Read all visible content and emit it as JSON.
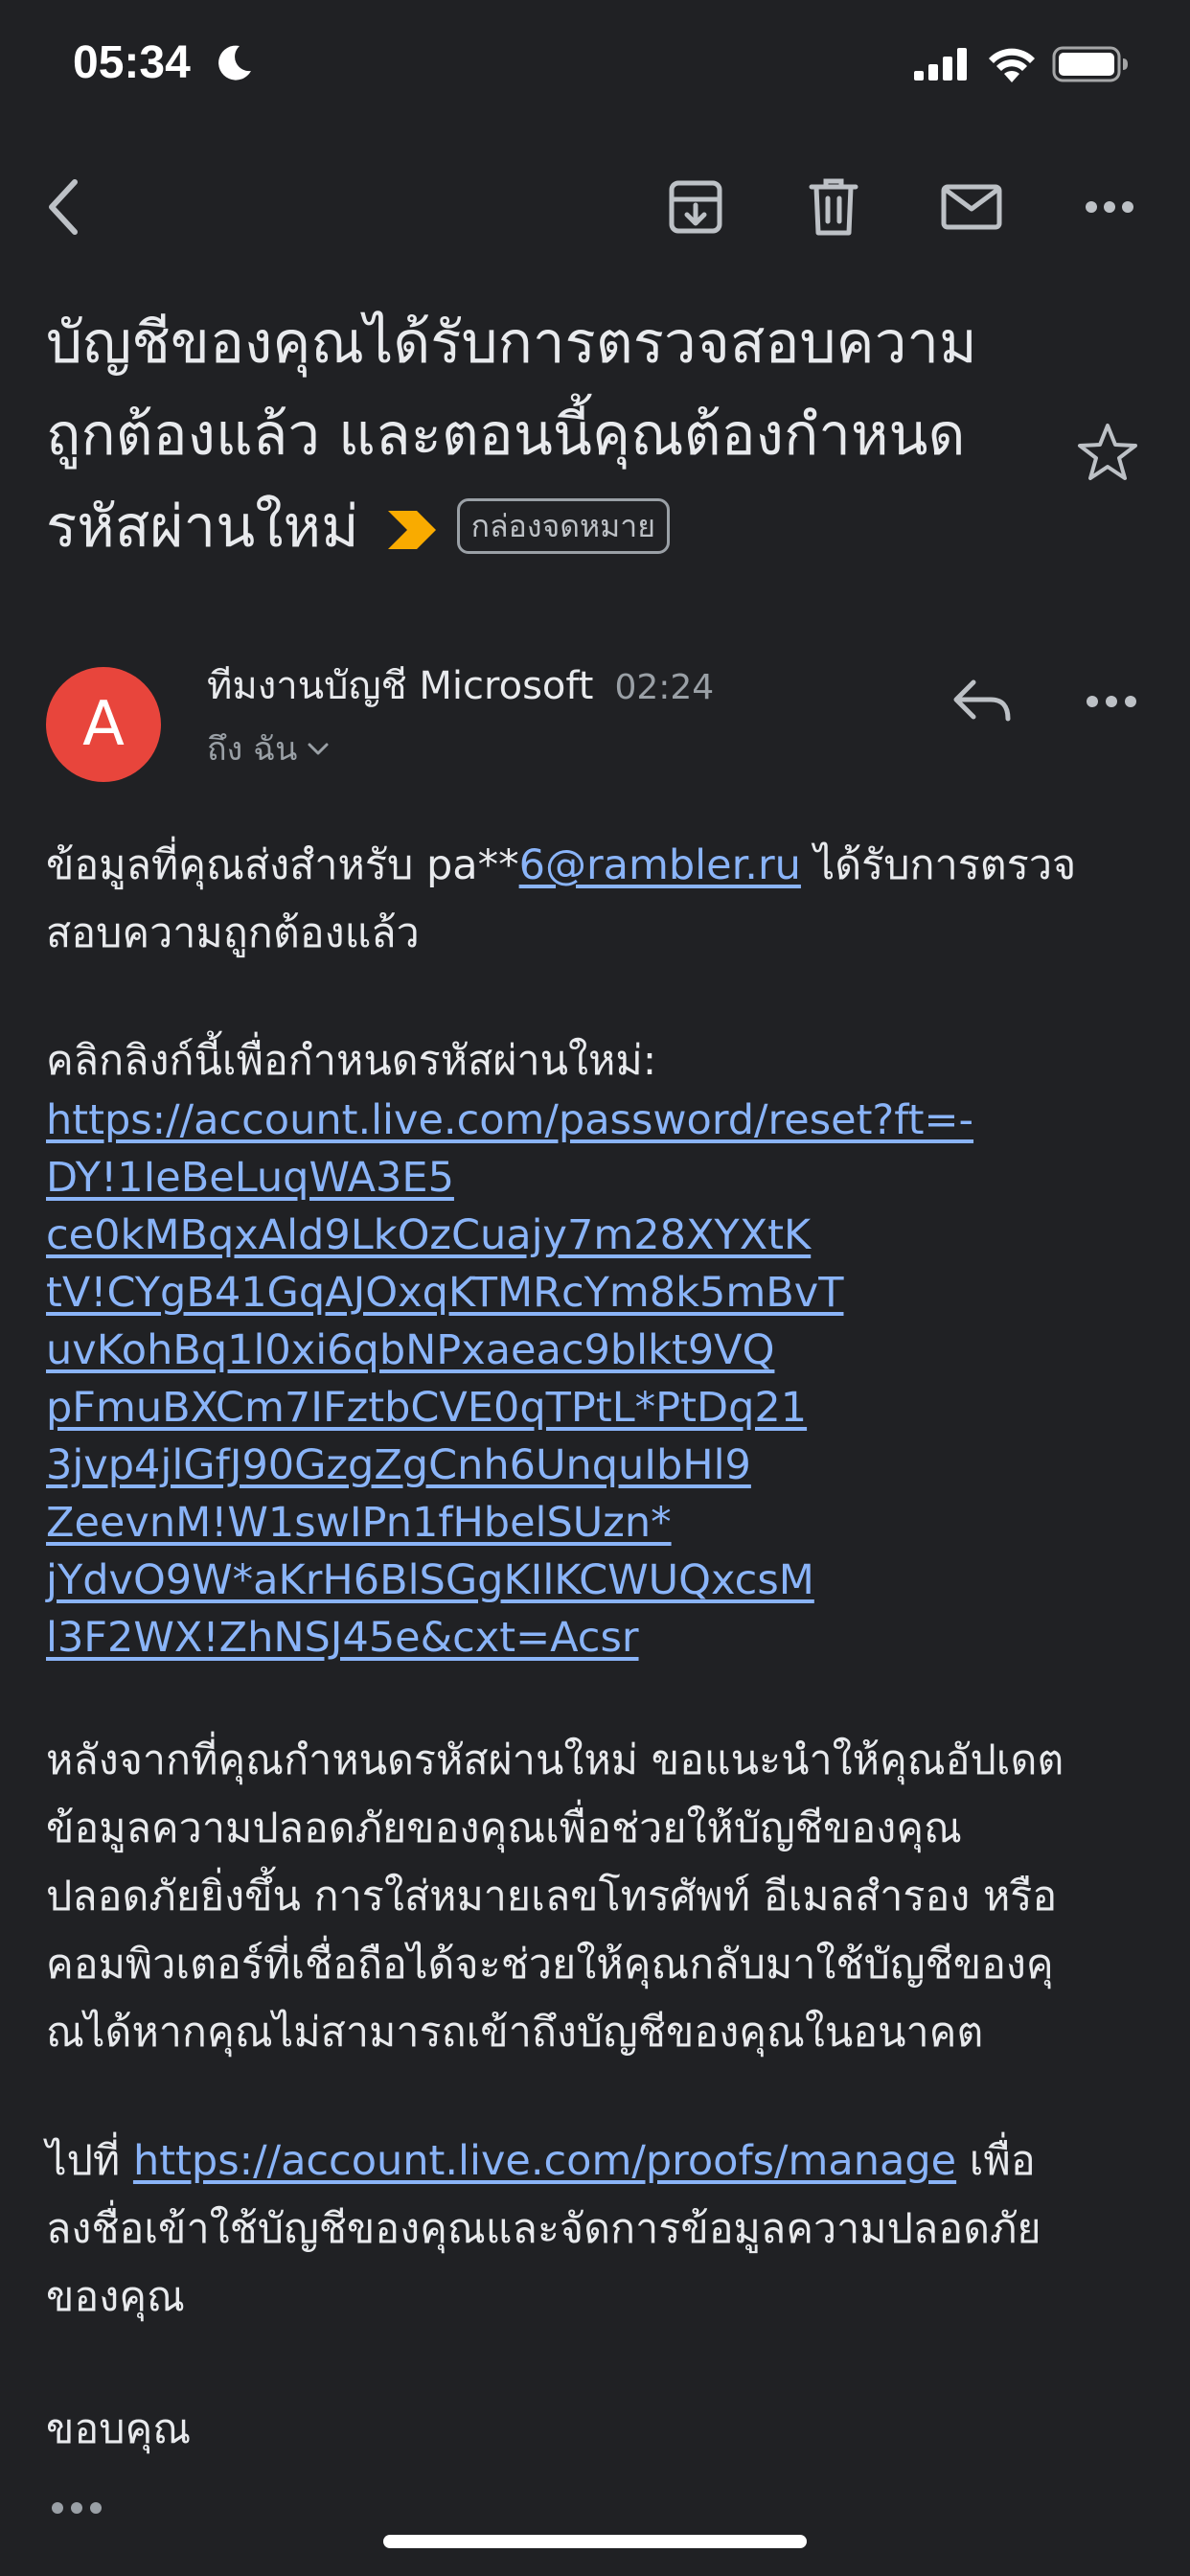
{
  "status_bar": {
    "time": "05:34",
    "icons": [
      "moon-icon",
      "signal-icon",
      "wifi-icon",
      "battery-icon"
    ]
  },
  "toolbar": {
    "icons": [
      "back-arrow-icon",
      "archive-icon",
      "trash-icon",
      "mail-icon",
      "more-icon"
    ]
  },
  "email": {
    "subject_lines": [
      "บัญชีของคุณได้รับการตรวจสอบความ",
      "ถูกต้องแล้ว และตอนนี้คุณต้องกำหนด",
      "รหัสผ่านใหม่"
    ],
    "label": "กล่องจดหมาย",
    "sender": {
      "initial": "A",
      "name": "ทีมงานบัญชี Microsoft",
      "time": "02:24",
      "recipient": "ถึง ฉัน"
    },
    "body": {
      "para1_prefix": "ข้อมูลที่คุณส่งสำหรับ pa**",
      "para1_email": "6@rambler.ru",
      "para1_suffix": " ได้รับการตรวจ",
      "para1_line2": "สอบความถูกต้องแล้ว",
      "para2_intro": "คลิกลิงก์นี้เพื่อกำหนดรหัสผ่านใหม่:",
      "reset_link_lines": [
        "https://account.live.com/password/reset?ft=-",
        "DY!1IeBeLuqWA3E5",
        "ce0kMBqxAld9LkOzCuajy7m28XYXtK",
        "tV!CYgB41GqAJOxqKTMRcYm8k5mBvT",
        "uvKohBq1l0xi6qbNPxaeac9blkt9VQ",
        "pFmuBXCm7IFztbCVE0qTPtL*PtDq21",
        "3jvp4jlGfJ90GzgZgCnh6UnquIbHl9",
        "ZeevnM!W1swIPn1fHbelSUzn*",
        "jYdvO9W*aKrH6BlSGgKIlKCWUQxcsM",
        "l3F2WX!ZhNSJ45e&cxt=Acsr"
      ],
      "para3_lines": [
        "หลังจากที่คุณกำหนดรหัสผ่านใหม่ ขอแนะนำให้คุณอัปเดต",
        "ข้อมูลความปลอดภัยของคุณเพื่อช่วยให้บัญชีของคุณ",
        "ปลอดภัยยิ่งขึ้น การใส่หมายเลขโทรศัพท์ อีเมลสำรอง หรือ",
        "คอมพิวเตอร์ที่เชื่อถือได้จะช่วยให้คุณกลับมาใช้บัญชีของคุ",
        "ณได้หากคุณไม่สามารถเข้าถึงบัญชีของคุณในอนาคต"
      ],
      "para4_prefix": "ไปที่ ",
      "proofs_link": "https://account.live.com/proofs/manage",
      "para4_suffix": " เพื่อ",
      "para4_line2": "ลงชื่อเข้าใช้บัญชีของคุณและจัดการข้อมูลความปลอดภัย",
      "para4_line3": "ของคุณ",
      "closing": "ขอบคุณ"
    }
  },
  "colors": {
    "background": "#202124",
    "text": "#e8eaed",
    "secondary_text": "#9aa0a6",
    "link": "#8ab4f8",
    "avatar": "#e8453c",
    "importance_marker": "#f9ab00"
  }
}
